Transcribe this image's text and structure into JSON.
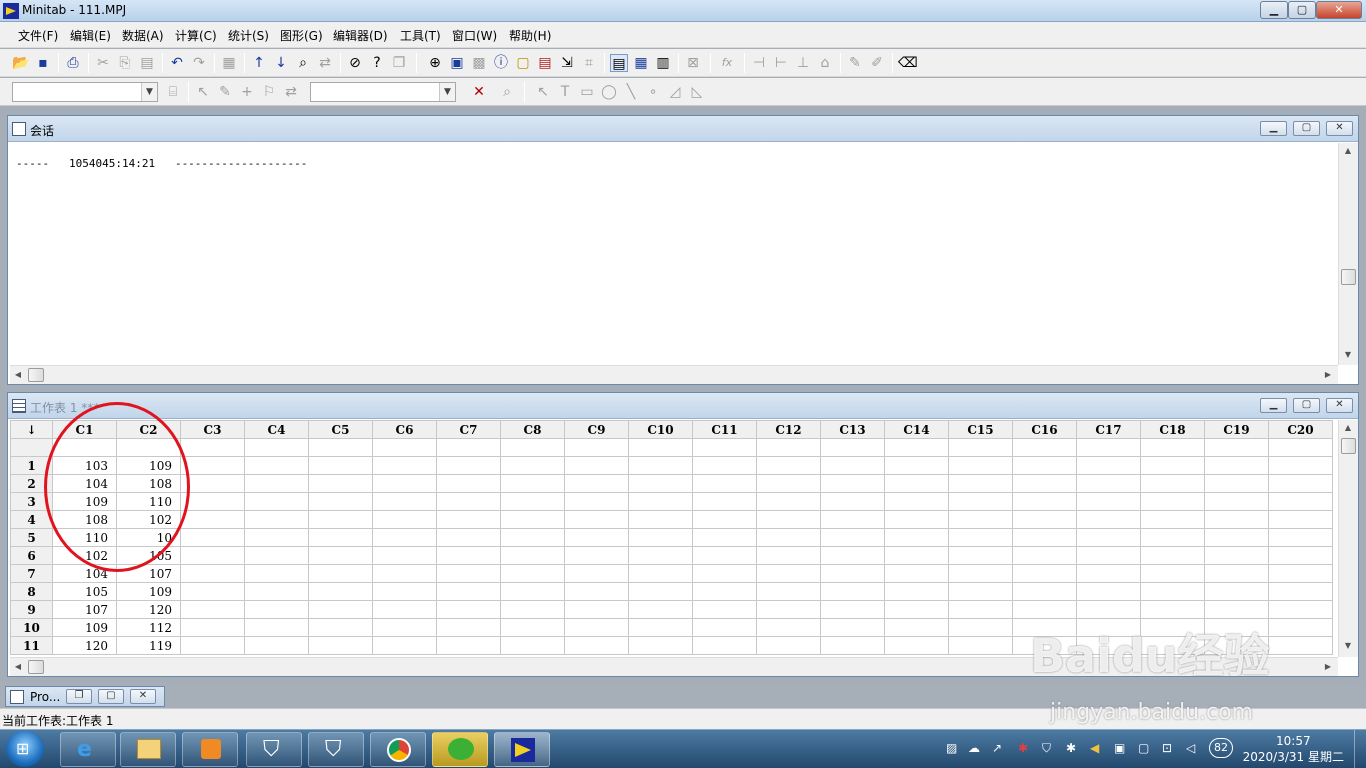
{
  "window": {
    "title": "Minitab - 111.MPJ",
    "min": "▁",
    "max": "▢",
    "close": "✕"
  },
  "menu": [
    "文件(F)",
    "编辑(E)",
    "数据(A)",
    "计算(C)",
    "统计(S)",
    "图形(G)",
    "编辑器(D)",
    "工具(T)",
    "窗口(W)",
    "帮助(H)"
  ],
  "toolbar1_icons": [
    "open-icon",
    "save-icon",
    "print-icon",
    "cut-icon",
    "copy-icon",
    "paste-icon",
    "undo-icon",
    "redo-icon",
    "report-icon",
    "up-arrow-icon",
    "down-arrow-icon",
    "find-icon",
    "replace-icon",
    "cancel-icon",
    "help-icon",
    "stack-icon",
    "session-icon",
    "worksheet-icon",
    "graph-icon",
    "info-icon",
    "history-icon",
    "related-icon",
    "show-worksheet-icon",
    "layout-icon",
    "session-window-icon",
    "data-window-icon",
    "project-manager-icon",
    "close-graph-icon",
    "fx-icon",
    "row-insert-icon",
    "column-insert-icon",
    "move-icon",
    "clear-icon",
    "brush-icon",
    "eraser-icon"
  ],
  "session": {
    "title": "会话",
    "line": "-----   1054045:14:21   --------------------"
  },
  "worksheet": {
    "title": "工作表 1 ***",
    "corner": "↓",
    "columns": [
      "C1",
      "C2",
      "C3",
      "C4",
      "C5",
      "C6",
      "C7",
      "C8",
      "C9",
      "C10",
      "C11",
      "C12",
      "C13",
      "C14",
      "C15",
      "C16",
      "C17",
      "C18",
      "C19",
      "C20"
    ],
    "rows": [
      {
        "n": "1",
        "c1": "103",
        "c2": "109"
      },
      {
        "n": "2",
        "c1": "104",
        "c2": "108"
      },
      {
        "n": "3",
        "c1": "109",
        "c2": "110"
      },
      {
        "n": "4",
        "c1": "108",
        "c2": "102"
      },
      {
        "n": "5",
        "c1": "110",
        "c2": "10"
      },
      {
        "n": "6",
        "c1": "102",
        "c2": "105"
      },
      {
        "n": "7",
        "c1": "104",
        "c2": "107"
      },
      {
        "n": "8",
        "c1": "105",
        "c2": "109"
      },
      {
        "n": "9",
        "c1": "107",
        "c2": "120"
      },
      {
        "n": "10",
        "c1": "109",
        "c2": "112"
      },
      {
        "n": "11",
        "c1": "120",
        "c2": "119"
      }
    ]
  },
  "minimized": {
    "label": "Pro..."
  },
  "status": "当前工作表:工作表 1",
  "taskbar": {
    "time": "10:57",
    "date": "2020/3/31 星期二",
    "badge": "82"
  },
  "watermark": {
    "brand": "Baidu经验",
    "site": "jingyan.baidu.com"
  },
  "annotation_color": "#e0141e"
}
